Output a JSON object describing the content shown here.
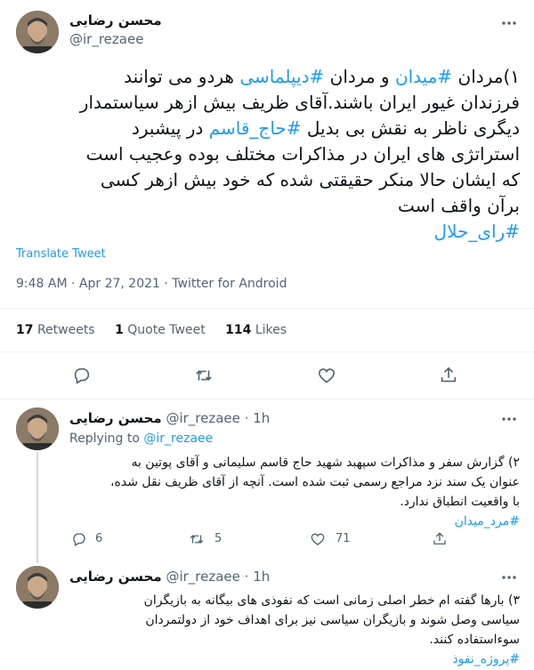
{
  "main_tweet": {
    "author_name": "محسن رضایی",
    "author_handle": "@ir_rezaee",
    "body_lines": [
      "۱)مردان #میدان و مردان #دیپلماسی هردو می توانند",
      "فرزندان غیور ایران باشند.آقای ظریف بیش ازهر سیاستمدار",
      "دیگری ناظر به نقش بی بدیل #حاج_قاسم در پیشبرد",
      "استراتژی های ایران در مذاکرات مختلف بوده وعجیب است",
      "که ایشان حالا منکر حقیقتی شده که خود بیش ازهر کسی",
      "برآن واقف است"
    ],
    "line1": {
      "a": "۱)مردان ",
      "h1": "#میدان",
      "b": " و مردان ",
      "h2": "#دیپلماسی",
      "c": " هردو می توانند"
    },
    "line3": {
      "a": "دیگری ناظر به نقش بی بدیل ",
      "h": "#حاج_قاسم",
      "b": " در پیشبرد"
    },
    "hashtag_last": "#رای_حلال",
    "translate_label": "Translate Tweet",
    "timestamp": "9:48 AM · Apr 27, 2021 · Twitter for Android",
    "stats": {
      "retweets_count": "17",
      "retweets_label": "Retweets",
      "quotes_count": "1",
      "quotes_label": "Quote Tweet",
      "likes_count": "114",
      "likes_label": "Likes"
    }
  },
  "replies": [
    {
      "author_name": "محسن رضایی",
      "author_handle": "@ir_rezaee",
      "time": "· 1h",
      "replying_prefix": "Replying to",
      "replying_handle": "@ir_rezaee",
      "body_lines": [
        "۲) گزارش سفر و مذاکرات سپهبد شهید حاج قاسم سلیمانی و آقای پوتین به",
        "عنوان یک سند نزد مراجع رسمی ثبت شده است. آنچه از  آقای ظریف نقل شده،",
        "با واقعیت انطباق ندارد."
      ],
      "hashtag": "#مرد_میدان",
      "reply_count": "6",
      "retweet_count": "5",
      "like_count": "71"
    },
    {
      "author_name": "محسن رضایی",
      "author_handle": "@ir_rezaee",
      "time": "· 1h",
      "body_lines": [
        "۳) بارها گفته ام خطر اصلی زمانی است که نفوذی های بیگانه به بازیگران",
        "سیاسی وصل شوند و بازیگران سیاسی نیز برای اهداف خود از دولتمردان",
        "سوءاستفاده کنند."
      ],
      "hashtag": "#پروژه_نفوذ"
    }
  ],
  "colors": {
    "accent": "#1d9bf0",
    "muted": "#536471",
    "text": "#0f1419",
    "divider": "#eff3f4"
  }
}
